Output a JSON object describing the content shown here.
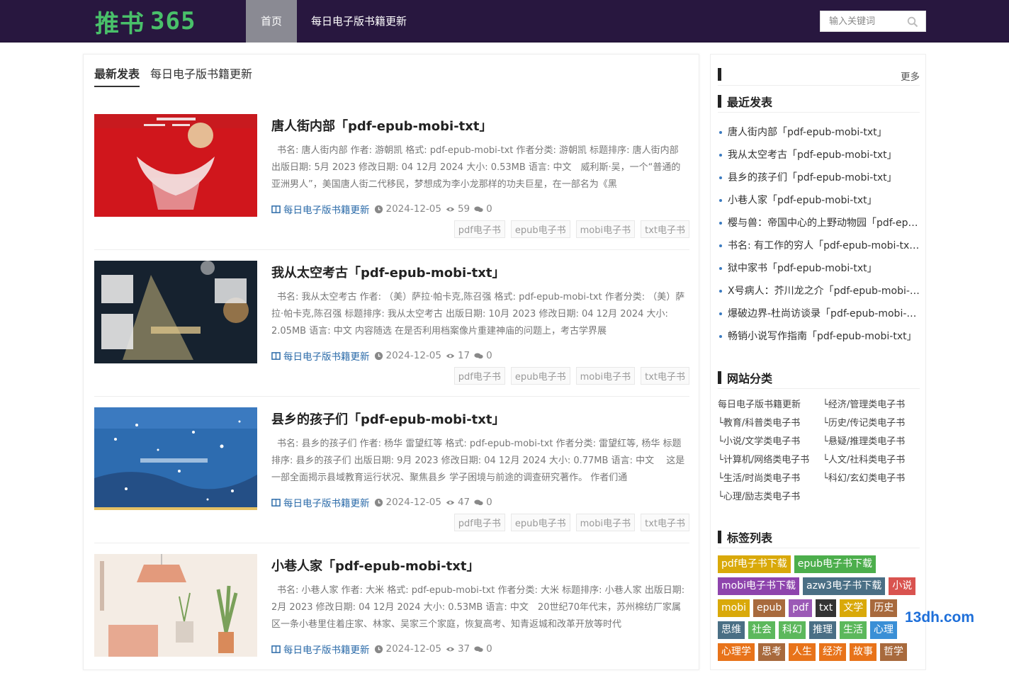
{
  "header": {
    "logo_cn": "推书",
    "logo_num": "365",
    "nav": [
      {
        "label": "首页"
      },
      {
        "label": "每日电子版书籍更新"
      }
    ],
    "search_placeholder": "输入关键词"
  },
  "main": {
    "tabs": [
      {
        "label": "最新发表"
      },
      {
        "label": "每日电子版书籍更新"
      }
    ],
    "posts": [
      {
        "title": "唐人街内部「pdf-epub-mobi-txt」",
        "excerpt": "书名: 唐人街内部 作者: 游朝凯 格式: pdf-epub-mobi-txt 作者分类: 游朝凯 标题排序: 唐人街内部 出版日期: 5月 2023 修改日期: 04 12月 2024 大小: 0.53MB 语言: 中文　威利斯·吴，一个“普通的亚洲男人”，美国唐人街二代移民，梦想成为李小龙那样的功夫巨星，在一部名为《黑",
        "category": "每日电子版书籍更新",
        "date": "2024-12-05",
        "views": "59",
        "comments": "0",
        "tags": [
          "pdf电子书",
          "epub电子书",
          "mobi电子书",
          "txt电子书"
        ]
      },
      {
        "title": "我从太空考古「pdf-epub-mobi-txt」",
        "excerpt": "书名: 我从太空考古 作者: （美）萨拉·帕卡克,陈召强 格式: pdf-epub-mobi-txt 作者分类: （美）萨拉·帕卡克,陈召强 标题排序: 我从太空考古 出版日期: 10月 2023 修改日期: 04 12月 2024 大小: 2.05MB 语言: 中文 内容随选 在是否利用档案像片重建神庙的问题上，考古学界展",
        "category": "每日电子版书籍更新",
        "date": "2024-12-05",
        "views": "17",
        "comments": "0",
        "tags": [
          "pdf电子书",
          "epub电子书",
          "mobi电子书",
          "txt电子书"
        ]
      },
      {
        "title": "县乡的孩子们「pdf-epub-mobi-txt」",
        "excerpt": "书名: 县乡的孩子们 作者: 杨华 雷望红等 格式: pdf-epub-mobi-txt 作者分类: 雷望红等, 杨华 标题排序: 县乡的孩子们 出版日期: 9月 2023 修改日期: 04 12月 2024 大小: 0.77MB 语言: 中文 　这是一部全面揭示县域教育运行状况、聚焦县乡 学子困境与前途的调查研究著作。 作者们通",
        "category": "每日电子版书籍更新",
        "date": "2024-12-05",
        "views": "47",
        "comments": "0",
        "tags": [
          "pdf电子书",
          "epub电子书",
          "mobi电子书",
          "txt电子书"
        ]
      },
      {
        "title": "小巷人家「pdf-epub-mobi-txt」",
        "excerpt": "书名: 小巷人家 作者: 大米 格式: pdf-epub-mobi-txt 作者分类: 大米 标题排序: 小巷人家 出版日期: 2月 2023 修改日期: 04 12月 2024 大小: 0.53MB 语言: 中文　20世纪70年代末，苏州棉纺厂家属区一条小巷里住着庄家、林家、吴家三个家庭，恢复高考、知青返城和改革开放等时代",
        "category": "每日电子版书籍更新",
        "date": "2024-12-05",
        "views": "37",
        "comments": "0",
        "tags": []
      }
    ]
  },
  "sidebar": {
    "more_label": "更多",
    "recent_title": "最近发表",
    "recent": [
      "唐人街内部「pdf-epub-mobi-txt」",
      "我从太空考古「pdf-epub-mobi-txt」",
      "县乡的孩子们「pdf-epub-mobi-txt」",
      "小巷人家「pdf-epub-mobi-txt」",
      "樱与兽：帝国中心的上野动物园「pdf-epub-mobi-txt」",
      "书名: 有工作的穷人「pdf-epub-mobi-txt」",
      "狱中家书「pdf-epub-mobi-txt」",
      "X号病人：芥川龙之介「pdf-epub-mobi-txt」",
      "爆破边界-杜尚访谈录「pdf-epub-mobi-txt」",
      "畅销小说写作指南「pdf-epub-mobi-txt」"
    ],
    "categories_title": "网站分类",
    "categories": [
      "每日电子版书籍更新",
      "└经济/管理类电子书",
      "└教育/科普类电子书",
      "└历史/传记类电子书",
      "└小说/文学类电子书",
      "└悬疑/推理类电子书",
      "└计算机/网络类电子书",
      "└人文/社科类电子书",
      "└生活/时尚类电子书",
      "└科幻/玄幻类电子书",
      "└心理/励志类电子书"
    ],
    "tags_title": "标签列表",
    "tag_cloud": [
      {
        "label": "pdf电子书下载",
        "color": "#d9a90a"
      },
      {
        "label": "epub电子书下载",
        "color": "#4cae4c"
      },
      {
        "label": "mobi电子书下载",
        "color": "#8e44ad"
      },
      {
        "label": "azw3电子书下载",
        "color": "#4a6f85"
      },
      {
        "label": "小说",
        "color": "#d9534f"
      },
      {
        "label": "mobi",
        "color": "#d9a90a"
      },
      {
        "label": "epub",
        "color": "#a86a3d"
      },
      {
        "label": "pdf",
        "color": "#9b59b6"
      },
      {
        "label": "txt",
        "color": "#333333"
      },
      {
        "label": "文学",
        "color": "#d9a90a"
      },
      {
        "label": "历史",
        "color": "#a86a3d"
      },
      {
        "label": "思维",
        "color": "#4a6f85"
      },
      {
        "label": "社会",
        "color": "#5cb85c"
      },
      {
        "label": "科幻",
        "color": "#5cb85c"
      },
      {
        "label": "推理",
        "color": "#4a6f85"
      },
      {
        "label": "生活",
        "color": "#5cb85c"
      },
      {
        "label": "心理",
        "color": "#3a8fd6"
      },
      {
        "label": "心理学",
        "color": "#e8731a"
      },
      {
        "label": "思考",
        "color": "#a86a3d"
      },
      {
        "label": "人生",
        "color": "#e8731a"
      },
      {
        "label": "经济",
        "color": "#e8731a"
      },
      {
        "label": "故事",
        "color": "#e8731a"
      },
      {
        "label": "哲学",
        "color": "#a86a3d"
      }
    ]
  },
  "watermark": "13dh.com"
}
